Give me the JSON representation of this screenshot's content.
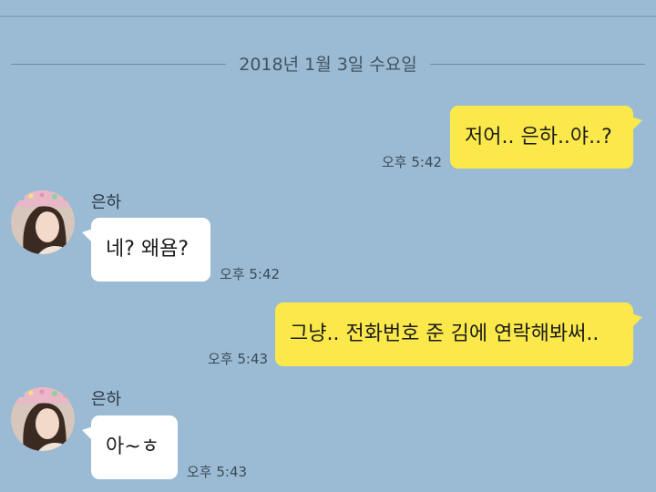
{
  "date_divider": "2018년 1월 3일 수요일",
  "messages": [
    {
      "text": "저어.. 은하..야..?",
      "time": "오후 5:42"
    },
    {
      "sender": "은하",
      "text": "네? 왜욤?",
      "time": "오후 5:42"
    },
    {
      "text": "그냥.. 전화번호 준 김에 연락해봐써..",
      "time": "오후 5:43"
    },
    {
      "sender": "은하",
      "text": "아~ㅎ",
      "time": "오후 5:43"
    }
  ],
  "colors": {
    "background": "#9bbbd4",
    "outgoing_bubble": "#fbe94b",
    "incoming_bubble": "#ffffff"
  }
}
